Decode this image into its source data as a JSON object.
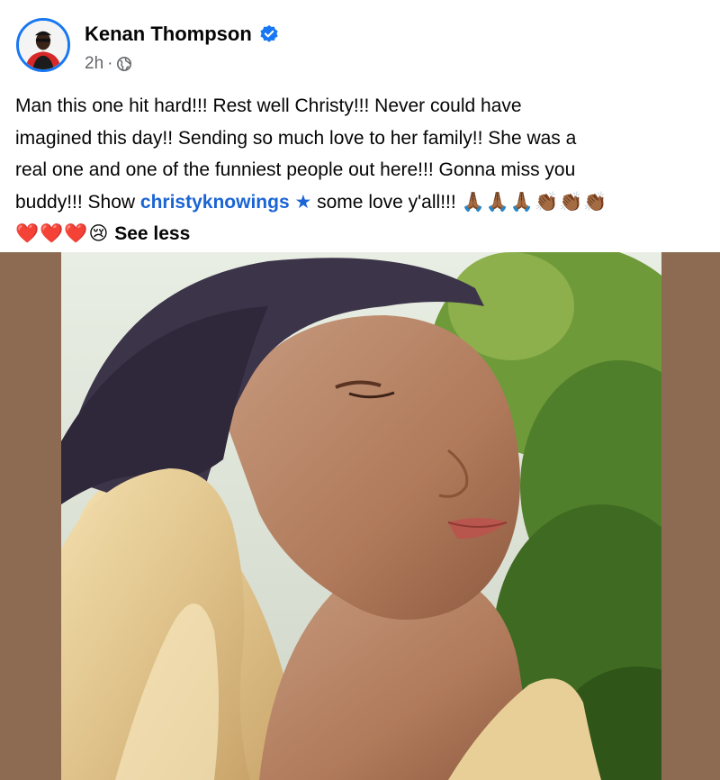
{
  "post": {
    "author": "Kenan Thompson",
    "timestamp": "2h",
    "separator": "·",
    "verified": true,
    "text_lines": [
      "Man this one hit hard!!! Rest well Christy!!! Never could have",
      "imagined this day!! Sending so much love to her family!! She was a",
      "real one and one of the funniest people out here!!! Gonna miss you"
    ],
    "line4_prefix": "buddy!!! Show ",
    "tag": "christyknowings",
    "tag_star": "★",
    "line4_suffix": " some love y'all!!! ",
    "emoji_line4": "🙏🏾🙏🏾🙏🏾👏🏾👏🏾👏🏾",
    "emoji_line5": "❤️❤️❤️😢",
    "see_less": "See less"
  },
  "colors": {
    "accent": "#1877f2",
    "link": "#1b64d4",
    "meta": "#65676b",
    "media_frame": "#8c6b52"
  },
  "icons": {
    "verified": "verified-badge-icon",
    "privacy": "globe-icon"
  }
}
